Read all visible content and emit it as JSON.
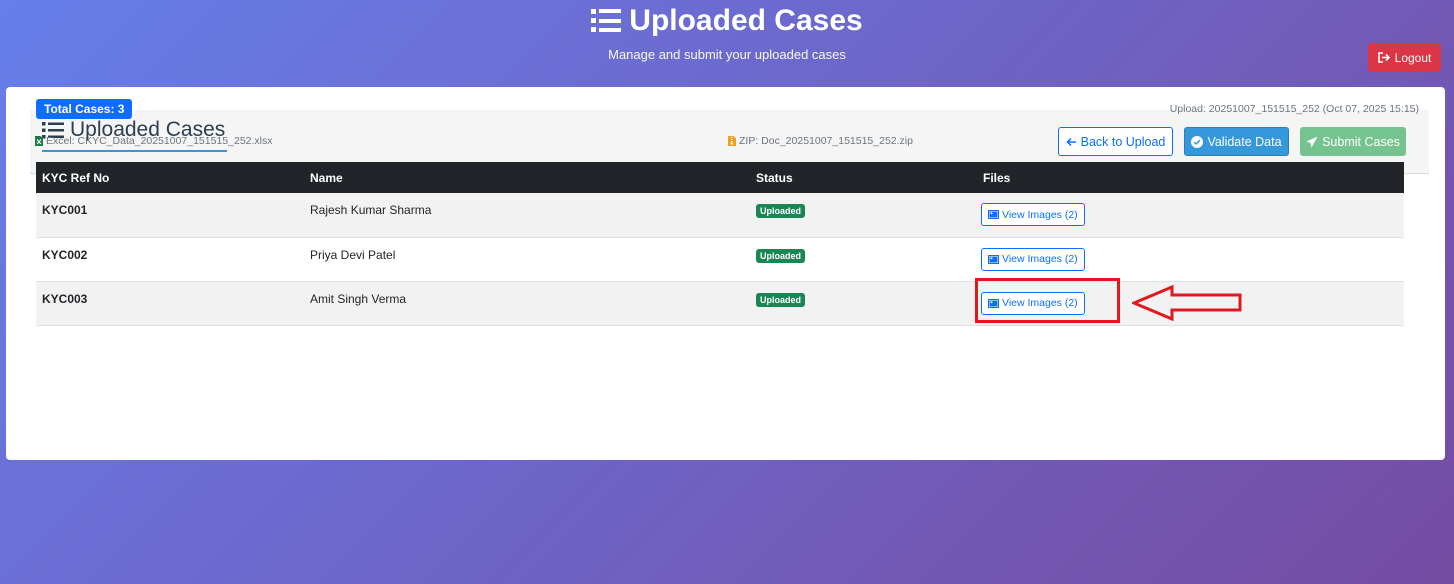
{
  "header": {
    "title": "Uploaded Cases",
    "subtitle": "Manage and submit your uploaded cases",
    "logout_label": "Logout"
  },
  "card": {
    "title": "Uploaded Cases",
    "buttons": {
      "back_label": "Back to Upload",
      "validate_label": "Validate Data",
      "submit_label": "Submit Cases"
    },
    "total_cases": "Total Cases: 3",
    "upload_info": "Upload: 20251007_151515_252 (Oct 07, 2025 15:15)",
    "excel_file": "Excel: CKYC_Data_20251007_151515_252.xlsx",
    "zip_file": "ZIP: Doc_20251007_151515_252.zip"
  },
  "table": {
    "headers": [
      "KYC Ref No",
      "Name",
      "Status",
      "Files"
    ],
    "rows": [
      {
        "ref": "KYC001",
        "name": "Rajesh Kumar Sharma",
        "status": "Uploaded",
        "files": "View Images (2)"
      },
      {
        "ref": "KYC002",
        "name": "Priya Devi Patel",
        "status": "Uploaded",
        "files": "View Images (2)"
      },
      {
        "ref": "KYC003",
        "name": "Amit Singh Verma",
        "status": "Uploaded",
        "files": "View Images (2)"
      }
    ]
  },
  "colors": {
    "primary": "#0d6efd",
    "danger": "#dc3545",
    "success": "#198754",
    "annotation": "#e0191f"
  },
  "icons": {
    "title": "list-icon",
    "logout": "sign-out-icon",
    "back": "arrow-left-icon",
    "validate": "check-circle-icon",
    "submit": "paper-plane-icon",
    "excel": "excel-file-icon",
    "zip": "zip-file-icon",
    "view": "image-icon"
  }
}
